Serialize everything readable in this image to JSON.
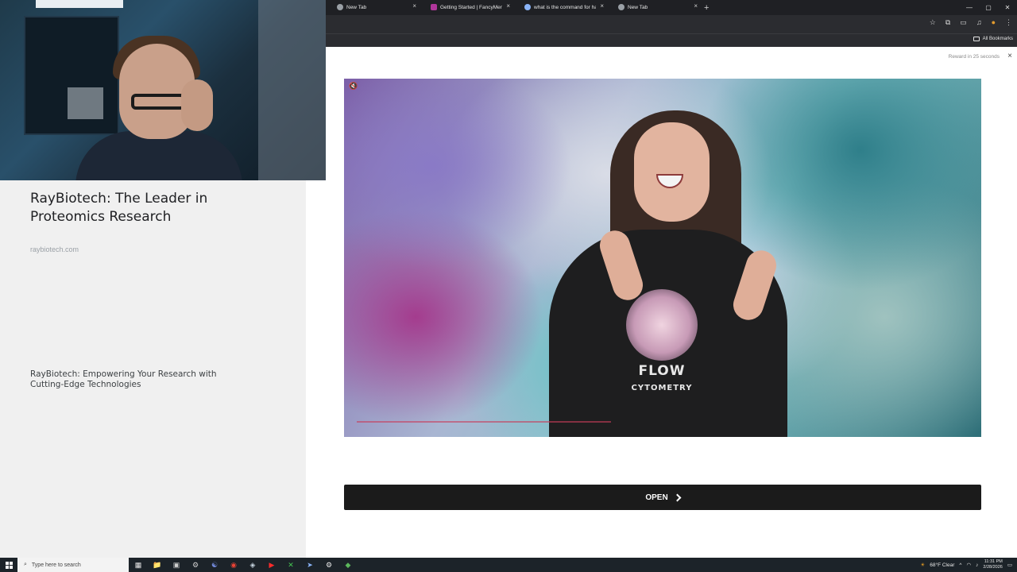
{
  "browser": {
    "tabs": [
      {
        "label": "New Tab",
        "favicon_color": "#9aa0a6"
      },
      {
        "label": "Getting Started | FancyMenu v",
        "favicon_color": "#b0369a"
      },
      {
        "label": "what is the command for hardc",
        "favicon_color": "#8ab4f8"
      },
      {
        "label": "New Tab",
        "favicon_color": "#9aa0a6"
      }
    ],
    "new_tab_symbol": "+",
    "window_controls": {
      "minimize": "—",
      "maximize": "▢",
      "close": "✕"
    },
    "toolbar_icons": {
      "star": "☆",
      "extensions": "⧉",
      "sidepanel": "▭",
      "media": "♫",
      "profile": "●",
      "menu": "⋮"
    },
    "bookmarks_label": "All Bookmarks",
    "tab_close": "×"
  },
  "ad": {
    "title": "RayBiotech: The Leader in Proteomics Research",
    "domain": "raybiotech.com",
    "description": "RayBiotech: Empowering Your Research with Cutting-Edge Technologies",
    "reward_text": "Reward in 25 seconds",
    "reward_close": "×",
    "mute_symbol": "🔇",
    "shirt_line1": "FLOW",
    "shirt_line2": "CYTOMETRY",
    "open_label": "OPEN"
  },
  "taskbar": {
    "search_placeholder": "Type here to search",
    "weather": "68°F  Clear",
    "time": "11:31 PM",
    "date": "2/28/2026",
    "apps": [
      "▦",
      "📁",
      "▣",
      "⚙",
      "☯",
      "◉",
      "◈",
      "▶",
      "✕",
      "➤",
      "⚙",
      "◆"
    ]
  }
}
